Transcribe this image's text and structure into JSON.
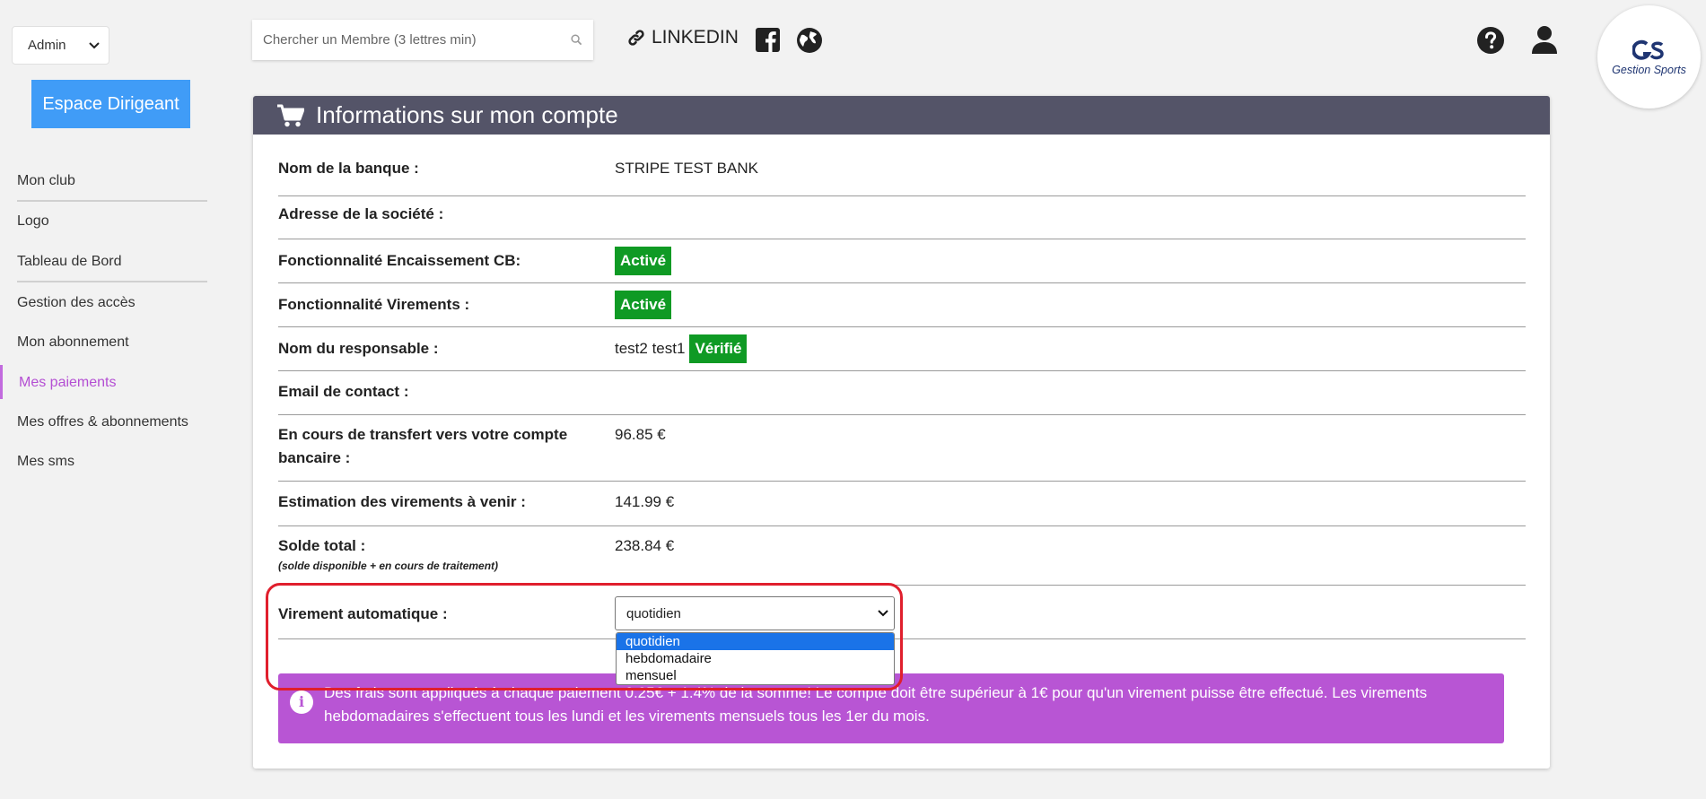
{
  "sidebar": {
    "role_select": {
      "value": "Admin"
    },
    "espace_button": "Espace Dirigeant",
    "items": [
      {
        "label": "Mon club"
      },
      {
        "label": "Logo"
      },
      {
        "label": "Tableau de Bord"
      },
      {
        "label": "Gestion des accès"
      },
      {
        "label": "Mon abonnement"
      },
      {
        "label": "Mes paiements",
        "active": true
      },
      {
        "label": "Mes offres & abonnements"
      },
      {
        "label": "Mes sms"
      }
    ],
    "active_color": "#b44fd3"
  },
  "topbar": {
    "search_placeholder": "Chercher un Membre (3 lettres min)",
    "linkedin_label": "LINKEDIN",
    "icons": [
      "link-icon",
      "facebook-icon",
      "globe-icon",
      "help-icon",
      "user-icon",
      "search-icon"
    ],
    "logo_text": "Gestion Sports"
  },
  "account": {
    "title": "Informations sur mon compte",
    "header_icon": "cart-icon",
    "rows": [
      {
        "label": "Nom de la banque :",
        "value": "STRIPE TEST BANK"
      },
      {
        "label": "Adresse de la société :",
        "value": ""
      },
      {
        "label": "Fonctionnalité Encaissement CB:",
        "badge": "Activé"
      },
      {
        "label": "Fonctionnalité Virements :",
        "badge": "Activé"
      },
      {
        "label": "Nom du responsable :",
        "value": "test2 test1",
        "badge": "Vérifié"
      },
      {
        "label": "Email de contact :",
        "value": ""
      },
      {
        "label": "En cours de transfert vers votre compte bancaire :",
        "value": "96.85 €"
      },
      {
        "label": "Estimation des virements à venir :",
        "value": "141.99 €"
      },
      {
        "label": "Solde total :",
        "note": "(solde disponible + en cours de traitement)",
        "value": "238.84 €"
      }
    ],
    "auto_transfer": {
      "label": "Virement automatique :",
      "selected": "quotidien",
      "options": [
        "quotidien",
        "hebdomadaire",
        "mensuel"
      ]
    },
    "alert_text": "Des frais sont appliqués à chaque paiement 0.25€ + 1.4% de la somme! Le compte doit être supérieur à 1€ pour qu'un virement puisse être effectué. Les virements hebdomadaires s'effectuent tous les lundi et les virements mensuels tous les 1er du mois.",
    "colors": {
      "badge_green": "#0f9a24",
      "header": "#545468",
      "alert": "#b855d4",
      "highlight": "#e01f2d"
    }
  }
}
